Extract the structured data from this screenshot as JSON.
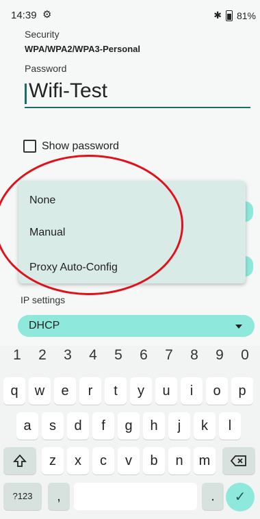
{
  "status_bar": {
    "time": "14:39",
    "battery": "81%"
  },
  "security": {
    "label": "Security",
    "value": "WPA/WPA2/WPA3-Personal"
  },
  "password": {
    "label": "Password",
    "value": "Wifi-Test"
  },
  "show_password": {
    "label": "Show password",
    "checked": false
  },
  "proxy_menu": {
    "items": [
      "None",
      "Manual",
      "Proxy Auto-Config"
    ]
  },
  "ip_settings": {
    "label": "IP settings",
    "value": "DHCP"
  },
  "keyboard": {
    "number_row": [
      "1",
      "2",
      "3",
      "4",
      "5",
      "6",
      "7",
      "8",
      "9",
      "0"
    ],
    "row1": [
      "q",
      "w",
      "e",
      "r",
      "t",
      "y",
      "u",
      "i",
      "o",
      "p"
    ],
    "row2": [
      "a",
      "s",
      "d",
      "f",
      "g",
      "h",
      "j",
      "k",
      "l"
    ],
    "row3": [
      "z",
      "x",
      "c",
      "v",
      "b",
      "n",
      "m"
    ],
    "symbols_key": "?123",
    "comma_key": ",",
    "period_key": ".",
    "shift_icon": "shift-icon",
    "backspace_icon": "backspace-icon",
    "enter_icon": "checkmark-icon"
  },
  "colors": {
    "accent": "#8fe8dc",
    "underline": "#1f6a64",
    "annotation": "#e0111b"
  }
}
